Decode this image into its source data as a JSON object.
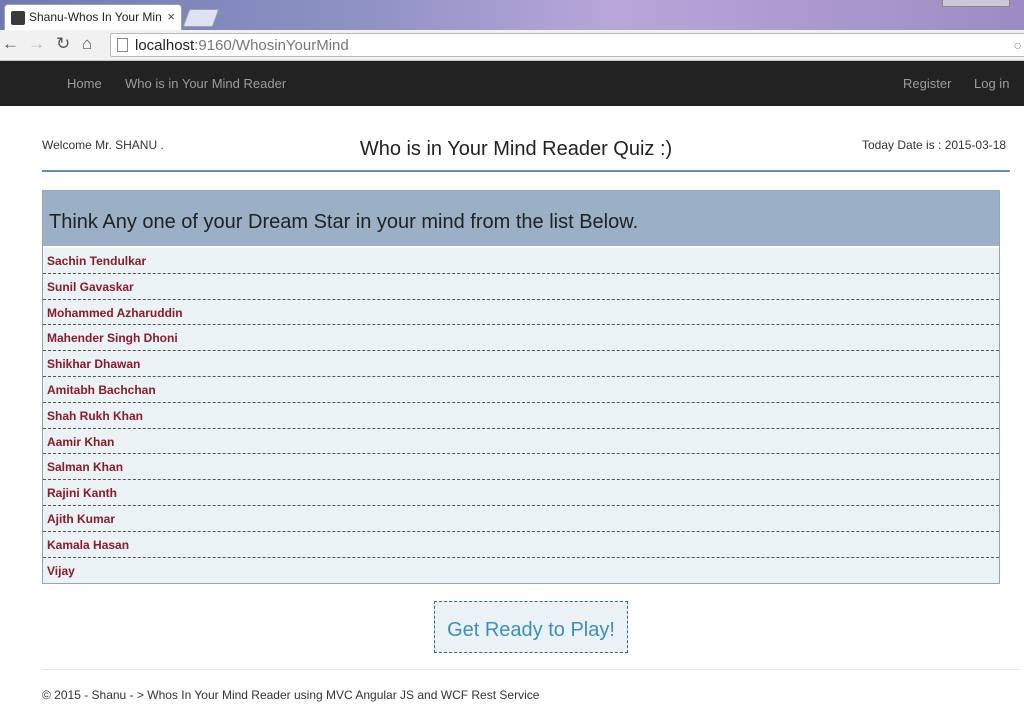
{
  "browser": {
    "tab_title": "Shanu-Whos In Your Min",
    "tab_close": "×",
    "url_host": "localhost",
    "url_path": ":9160/WhosinYourMind",
    "icons": {
      "back": "back-arrow-icon",
      "forward": "forward-arrow-icon",
      "reload": "reload-icon",
      "home": "home-icon"
    }
  },
  "navbar": {
    "home": "Home",
    "reader": "Who is in Your Mind Reader",
    "register": "Register",
    "login": "Log in"
  },
  "header": {
    "welcome": "Welcome Mr. SHANU .",
    "title": "Who is in Your Mind Reader Quiz :)",
    "today": "Today Date is : 2015-03-18"
  },
  "panel": {
    "heading": "Think Any one of your Dream Star in your mind from the list Below.",
    "stars": [
      "Sachin Tendulkar",
      "Sunil Gavaskar",
      "Mohammed Azharuddin",
      "Mahender Singh Dhoni",
      "Shikhar Dhawan",
      "Amitabh Bachchan",
      "Shah Rukh Khan",
      "Aamir Khan",
      "Salman Khan",
      "Rajini Kanth",
      "Ajith Kumar",
      "Kamala Hasan",
      "Vijay"
    ]
  },
  "play_button": "Get Ready to Play!",
  "footer": "© 2015 - Shanu - > Whos In Your Mind Reader using MVC Angular JS and WCF Rest Service",
  "colors": {
    "navbar": "#222222",
    "panel_header": "#9bb0c6",
    "panel_body": "#eaf2f6",
    "star_text": "#8b1a2b",
    "play_text": "#3a8fbd"
  }
}
